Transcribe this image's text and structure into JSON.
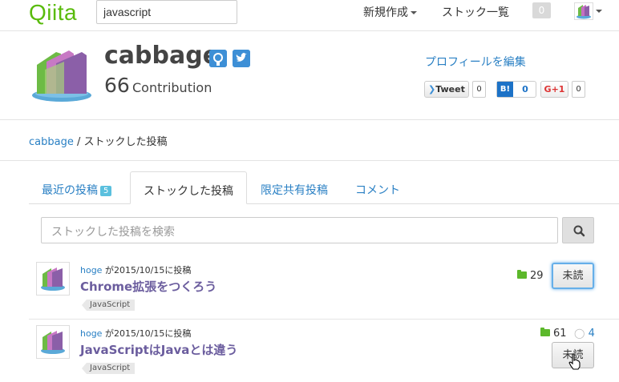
{
  "header": {
    "logo": "Qiita",
    "search_value": "javascript",
    "new_post_label": "新規作成",
    "stock_list_label": "ストック一覧",
    "notification_count": "0"
  },
  "profile": {
    "username": "cabbage",
    "contribution_count": "66",
    "contribution_label": "Contribution",
    "edit_profile_label": "プロフィールを編集",
    "tweet_label": "Tweet",
    "tweet_count": "0",
    "hatena_label": "B!",
    "hatena_count": "0",
    "gplus_label": "G+1",
    "gplus_count": "0"
  },
  "breadcrumb": {
    "user_link": "cabbage",
    "current": " / ストックした投稿"
  },
  "tabs": [
    {
      "label": "最近の投稿",
      "badge": "5"
    },
    {
      "label": "ストックした投稿"
    },
    {
      "label": "限定共有投稿"
    },
    {
      "label": "コメント"
    }
  ],
  "stock_search": {
    "placeholder": "ストックした投稿を検索"
  },
  "items": [
    {
      "author": "hoge",
      "meta_suffix": " が2015/10/15に投稿",
      "title": "Chrome拡張をつくろう",
      "tag": "JavaScript",
      "stock_count": "29",
      "comment_count": "",
      "unread_label": "未読"
    },
    {
      "author": "hoge",
      "meta_suffix": " が2015/10/15に投稿",
      "title": "JavaScriptはJavaとは違う",
      "tag": "JavaScript",
      "stock_count": "61",
      "comment_count": "4",
      "unread_label": "未読"
    }
  ],
  "colors": {
    "brand": "#59bb0c",
    "link": "#2a80c4",
    "title": "#6b5d9e",
    "stock_folder": "#5cb82b"
  }
}
